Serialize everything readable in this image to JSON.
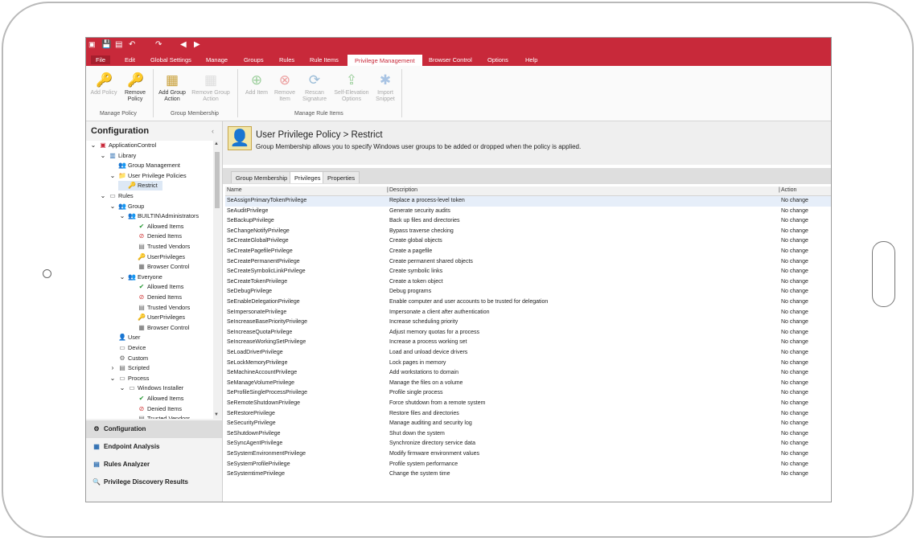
{
  "menu": [
    "File",
    "Edit",
    "Global Settings",
    "Manage",
    "Groups",
    "Rules",
    "Rule Items",
    "Privilege Management",
    "Browser Control",
    "Options",
    "Help"
  ],
  "ribbon": {
    "buttons": [
      {
        "label": "Add Policy",
        "icon": "key-add-icon",
        "disabled": true
      },
      {
        "label": "Remove Policy",
        "icon": "key-remove-icon",
        "disabled": false
      },
      {
        "label": "Add Group Action",
        "icon": "group-add-icon",
        "disabled": false
      },
      {
        "label": "Remove Group Action",
        "icon": "group-remove-icon",
        "disabled": true
      },
      {
        "label": "Add Item",
        "icon": "plus-circle-icon",
        "disabled": true
      },
      {
        "label": "Remove Item",
        "icon": "x-circle-icon",
        "disabled": true
      },
      {
        "label": "Rescan Signature",
        "icon": "rescan-icon",
        "disabled": true
      },
      {
        "label": "Self-Elevation Options",
        "icon": "elevate-icon",
        "disabled": true
      },
      {
        "label": "Import Snippet",
        "icon": "puzzle-icon",
        "disabled": true
      }
    ],
    "groups": [
      "Manage Policy",
      "Group Membership",
      "Manage Rule Items"
    ]
  },
  "left": {
    "title": "Configuration",
    "tree": [
      {
        "label": "ApplicationControl",
        "level": 0,
        "icon": "app-icon",
        "expander": "v"
      },
      {
        "label": "Library",
        "level": 1,
        "icon": "book-icon",
        "expander": "v"
      },
      {
        "label": "Group Management",
        "level": 2,
        "icon": "group-icon",
        "expander": ""
      },
      {
        "label": "User Privilege Policies",
        "level": 2,
        "icon": "folder-icon",
        "expander": "v"
      },
      {
        "label": "Restrict",
        "level": 3,
        "icon": "key-icon",
        "expander": "",
        "selected": true
      },
      {
        "label": "Rules",
        "level": 1,
        "icon": "rules-icon",
        "expander": "v"
      },
      {
        "label": "Group",
        "level": 2,
        "icon": "group-icon",
        "expander": "v"
      },
      {
        "label": "BUILTIN\\Administrators",
        "level": 3,
        "icon": "group-icon",
        "expander": "v"
      },
      {
        "label": "Allowed Items",
        "level": 4,
        "icon": "check-icon",
        "expander": ""
      },
      {
        "label": "Denied Items",
        "level": 4,
        "icon": "deny-icon",
        "expander": ""
      },
      {
        "label": "Trusted Vendors",
        "level": 4,
        "icon": "vendor-icon",
        "expander": ""
      },
      {
        "label": "UserPrivileges",
        "level": 4,
        "icon": "key-icon",
        "expander": ""
      },
      {
        "label": "Browser Control",
        "level": 4,
        "icon": "browser-icon",
        "expander": ""
      },
      {
        "label": "Everyone",
        "level": 3,
        "icon": "group-icon",
        "expander": "v"
      },
      {
        "label": "Allowed Items",
        "level": 4,
        "icon": "check-icon",
        "expander": ""
      },
      {
        "label": "Denied Items",
        "level": 4,
        "icon": "deny-icon",
        "expander": ""
      },
      {
        "label": "Trusted Vendors",
        "level": 4,
        "icon": "vendor-icon",
        "expander": ""
      },
      {
        "label": "UserPrivileges",
        "level": 4,
        "icon": "key-icon",
        "expander": ""
      },
      {
        "label": "Browser Control",
        "level": 4,
        "icon": "browser-icon",
        "expander": ""
      },
      {
        "label": "User",
        "level": 2,
        "icon": "user-icon",
        "expander": ""
      },
      {
        "label": "Device",
        "level": 2,
        "icon": "device-icon",
        "expander": ""
      },
      {
        "label": "Custom",
        "level": 2,
        "icon": "gear-icon",
        "expander": ""
      },
      {
        "label": "Scripted",
        "level": 2,
        "icon": "script-icon",
        "expander": ">"
      },
      {
        "label": "Process",
        "level": 2,
        "icon": "process-icon",
        "expander": "v"
      },
      {
        "label": "Windows Installer",
        "level": 3,
        "icon": "installer-icon",
        "expander": "v"
      },
      {
        "label": "Allowed Items",
        "level": 4,
        "icon": "check-icon",
        "expander": ""
      },
      {
        "label": "Denied Items",
        "level": 4,
        "icon": "deny-icon",
        "expander": ""
      },
      {
        "label": "Trusted Vendors",
        "level": 4,
        "icon": "vendor-icon",
        "expander": ""
      }
    ],
    "nav": [
      {
        "label": "Configuration",
        "icon": "gear-icon",
        "active": true
      },
      {
        "label": "Endpoint Analysis",
        "icon": "analysis-icon",
        "active": false
      },
      {
        "label": "Rules Analyzer",
        "icon": "analyzer-icon",
        "active": false
      },
      {
        "label": "Privilege Discovery Results",
        "icon": "discovery-icon",
        "active": false
      }
    ]
  },
  "content": {
    "title": "User Privilege Policy > Restrict",
    "description": "Group Membership allows you to specify Windows user groups to be added or dropped when the policy is applied.",
    "tabs": [
      "Group Membership",
      "Privileges",
      "Properties"
    ],
    "active_tab": 1,
    "columns": [
      "Name",
      "Description",
      "Action"
    ],
    "rows": [
      [
        "SeAssignPrimaryTokenPrivilege",
        "Replace a process-level token",
        "No change"
      ],
      [
        "SeAuditPrivilege",
        "Generate security audits",
        "No change"
      ],
      [
        "SeBackupPrivilege",
        "Back up files and directories",
        "No change"
      ],
      [
        "SeChangeNotifyPrivilege",
        "Bypass traverse checking",
        "No change"
      ],
      [
        "SeCreateGlobalPrivilege",
        "Create global objects",
        "No change"
      ],
      [
        "SeCreatePagefilePrivilege",
        "Create a pagefile",
        "No change"
      ],
      [
        "SeCreatePermanentPrivilege",
        "Create permanent shared objects",
        "No change"
      ],
      [
        "SeCreateSymbolicLinkPrivilege",
        "Create symbolic links",
        "No change"
      ],
      [
        "SeCreateTokenPrivilege",
        "Create a token object",
        "No change"
      ],
      [
        "SeDebugPrivilege",
        "Debug programs",
        "No change"
      ],
      [
        "SeEnableDelegationPrivilege",
        "Enable computer and user accounts to be trusted for delegation",
        "No change"
      ],
      [
        "SeImpersonatePrivilege",
        "Impersonate a client after authentication",
        "No change"
      ],
      [
        "SeIncreaseBasePriorityPrivilege",
        "Increase scheduling priority",
        "No change"
      ],
      [
        "SeIncreaseQuotaPrivilege",
        "Adjust memory quotas for a process",
        "No change"
      ],
      [
        "SeIncreaseWorkingSetPrivilege",
        "Increase a process working set",
        "No change"
      ],
      [
        "SeLoadDriverPrivilege",
        "Load and unload device drivers",
        "No change"
      ],
      [
        "SeLockMemoryPrivilege",
        "Lock pages in memory",
        "No change"
      ],
      [
        "SeMachineAccountPrivilege",
        "Add workstations to domain",
        "No change"
      ],
      [
        "SeManageVolumePrivilege",
        "Manage the files on a volume",
        "No change"
      ],
      [
        "SeProfileSingleProcessPrivilege",
        "Profile single process",
        "No change"
      ],
      [
        "SeRemoteShutdownPrivilege",
        "Force shutdown from a remote system",
        "No change"
      ],
      [
        "SeRestorePrivilege",
        "Restore files and directories",
        "No change"
      ],
      [
        "SeSecurityPrivilege",
        "Manage auditing and security log",
        "No change"
      ],
      [
        "SeShutdownPrivilege",
        "Shut down the system",
        "No change"
      ],
      [
        "SeSyncAgentPrivilege",
        "Synchronize directory service data",
        "No change"
      ],
      [
        "SeSystemEnvironmentPrivilege",
        "Modify firmware environment values",
        "No change"
      ],
      [
        "SeSystemProfilePrivilege",
        "Profile system performance",
        "No change"
      ],
      [
        "SeSystemtimePrivilege",
        "Change the system time",
        "No change"
      ]
    ]
  },
  "colors": {
    "accent": "#c8293a",
    "selected_row": "#e6eef9"
  }
}
